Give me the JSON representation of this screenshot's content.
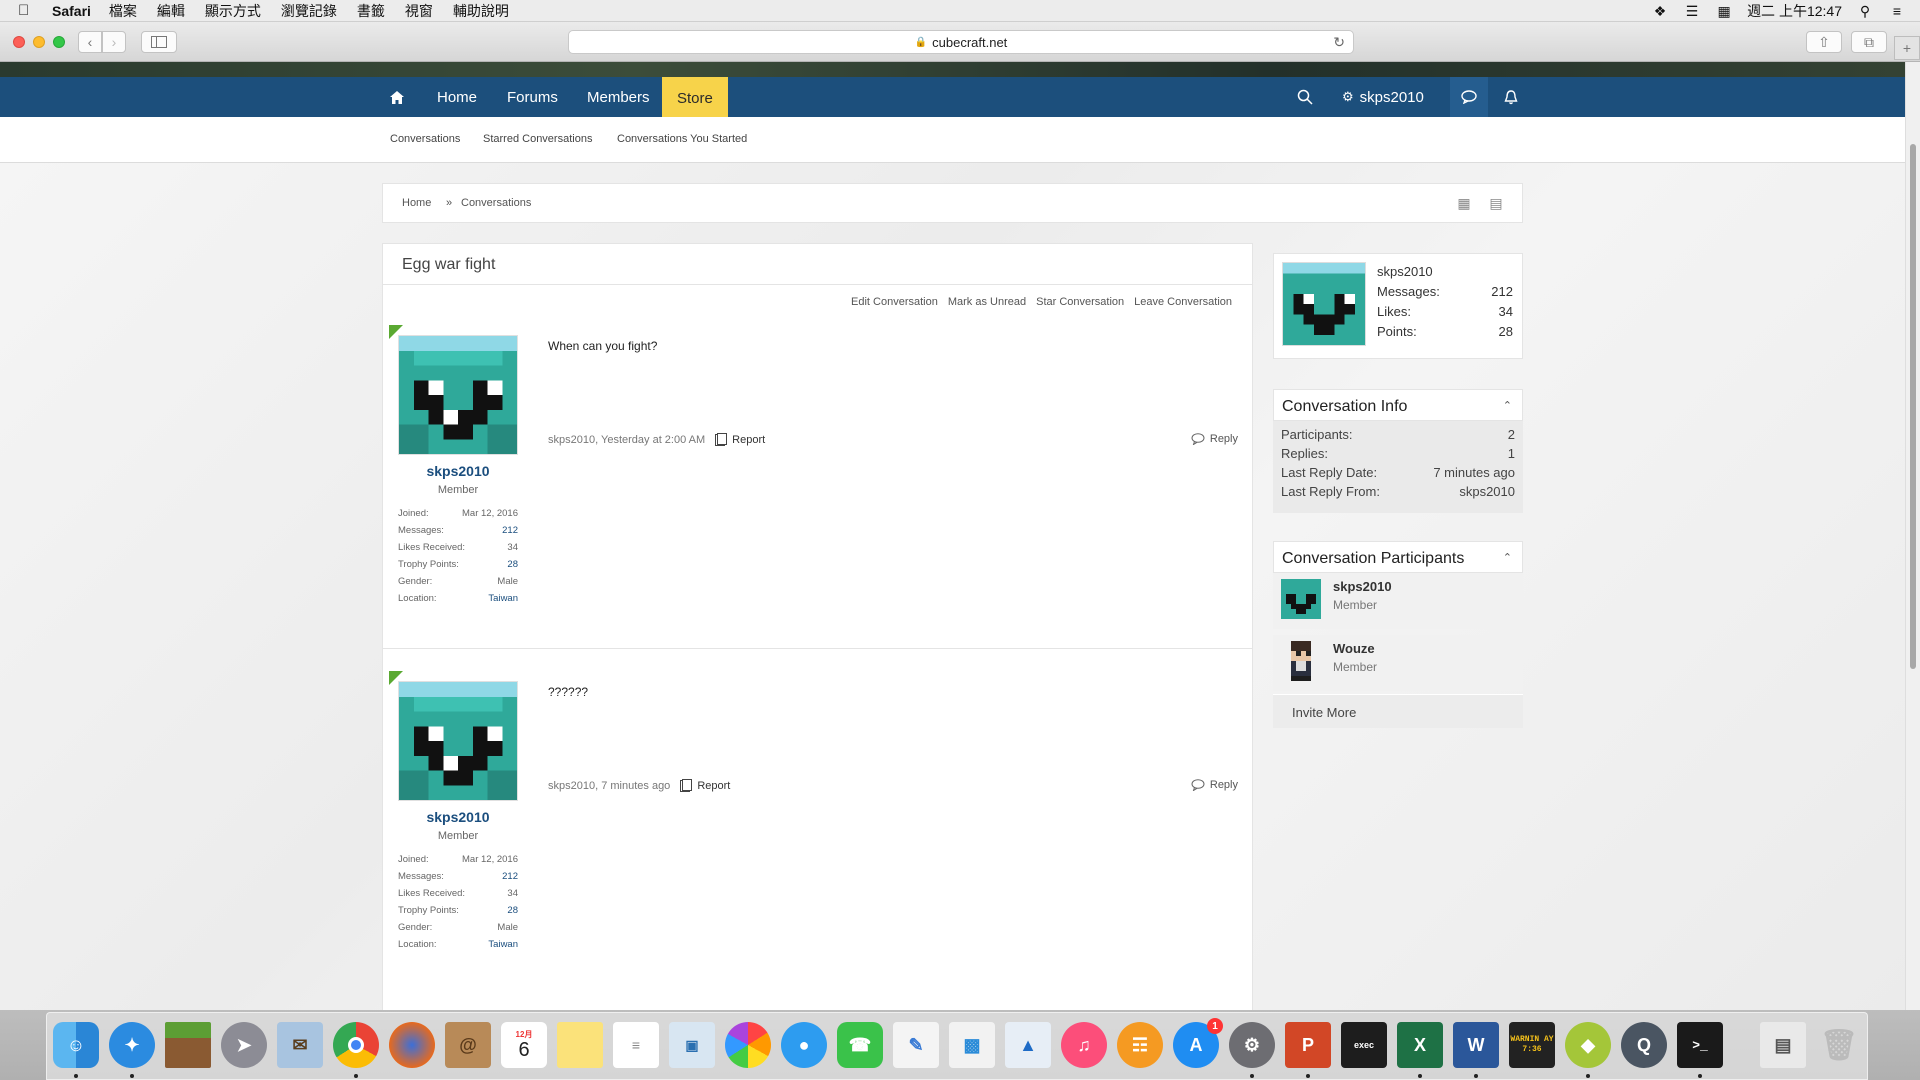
{
  "menubar": {
    "app": "Safari",
    "items": [
      "檔案",
      "編輯",
      "顯示方式",
      "瀏覽記錄",
      "書籤",
      "視窗",
      "輔助說明"
    ],
    "clock": "週二 上午12:47"
  },
  "browser": {
    "url": "cubecraft.net"
  },
  "nav": {
    "home": "Home",
    "forums": "Forums",
    "members": "Members",
    "store": "Store",
    "user": "skps2010"
  },
  "subnav": [
    "Conversations",
    "Starred Conversations",
    "Conversations You Started"
  ],
  "breadcrumb": [
    "Home",
    "»",
    "Conversations"
  ],
  "conversation": {
    "title": "Egg war fight",
    "actions": [
      "Edit Conversation",
      "Mark as Unread",
      "Star Conversation",
      "Leave Conversation"
    ],
    "messages": [
      {
        "text": "When can you fight?",
        "meta": "skps2010, Yesterday at 2:00 AM",
        "report": "Report",
        "reply": "Reply",
        "user": {
          "name": "skps2010",
          "title": "Member",
          "joined_label": "Joined:",
          "joined": "Mar 12, 2016",
          "messages_label": "Messages:",
          "messages": "212",
          "likes_label": "Likes Received:",
          "likes": "34",
          "trophy_label": "Trophy Points:",
          "trophy": "28",
          "gender_label": "Gender:",
          "gender": "Male",
          "location_label": "Location:",
          "location": "Taiwan"
        }
      },
      {
        "text": "??????",
        "meta": "skps2010, 7 minutes ago",
        "report": "Report",
        "reply": "Reply",
        "user": {
          "name": "skps2010",
          "title": "Member",
          "joined_label": "Joined:",
          "joined": "Mar 12, 2016",
          "messages_label": "Messages:",
          "messages": "212",
          "likes_label": "Likes Received:",
          "likes": "34",
          "trophy_label": "Trophy Points:",
          "trophy": "28",
          "gender_label": "Gender:",
          "gender": "Male",
          "location_label": "Location:",
          "location": "Taiwan"
        }
      }
    ]
  },
  "sidebar": {
    "user": {
      "name": "skps2010",
      "messages_label": "Messages:",
      "messages": "212",
      "likes_label": "Likes:",
      "likes": "34",
      "points_label": "Points:",
      "points": "28"
    },
    "info": {
      "title": "Conversation Info",
      "participants_label": "Participants:",
      "participants": "2",
      "replies_label": "Replies:",
      "replies": "1",
      "last_date_label": "Last Reply Date:",
      "last_date": "7 minutes ago",
      "last_from_label": "Last Reply From:",
      "last_from": "skps2010"
    },
    "participants": {
      "title": "Conversation Participants",
      "list": [
        {
          "name": "skps2010",
          "title": "Member"
        },
        {
          "name": "Wouze",
          "title": "Member"
        }
      ],
      "invite": "Invite More"
    }
  },
  "dock": {
    "calendar_day": "6",
    "calendar_month": "12月",
    "appstore_badge": "1",
    "console_text": "WARNIN AY 7:36"
  },
  "colors": {
    "navbar": "#1c4f7c",
    "store": "#f7d34a",
    "link": "#1b4e7e",
    "post_corner": "#5aa932"
  }
}
